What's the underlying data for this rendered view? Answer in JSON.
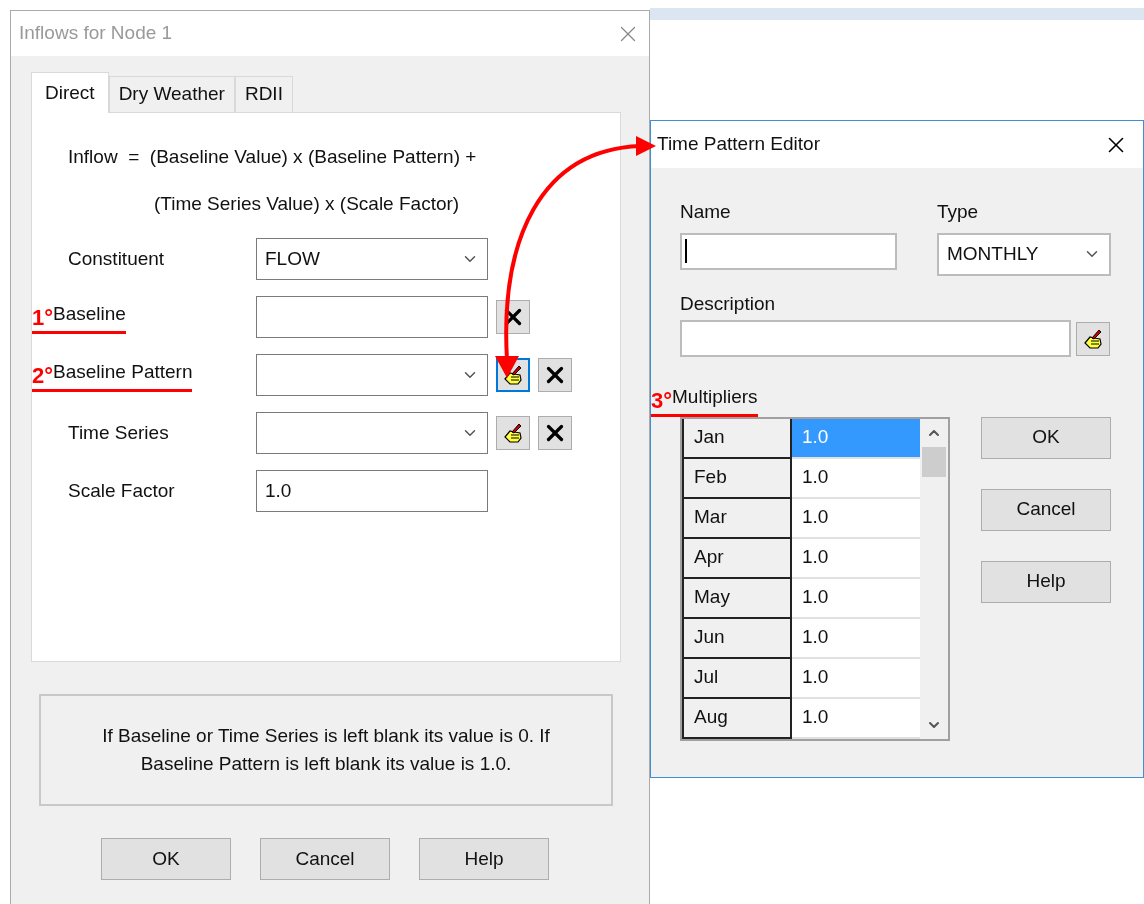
{
  "inflows_dialog": {
    "title": "Inflows for Node 1",
    "tabs": [
      {
        "label": "Direct",
        "selected": true
      },
      {
        "label": "Dry Weather",
        "selected": false
      },
      {
        "label": "RDII",
        "selected": false
      }
    ],
    "formula": [
      "Inflow  =  (Baseline Value) x (Baseline Pattern) +",
      "(Time Series Value) x (Scale Factor)"
    ],
    "fields": [
      {
        "label": "Constituent",
        "kind": "dropdown",
        "value": "FLOW"
      },
      {
        "label": "Baseline",
        "kind": "text",
        "annotation": "1°",
        "buttons": [
          {
            "kind": "clear",
            "focused": false
          }
        ]
      },
      {
        "label": "Baseline Pattern",
        "kind": "dropdown",
        "annotation": "2°",
        "buttons": [
          {
            "kind": "edit",
            "focused": true
          },
          {
            "kind": "clear",
            "focused": false
          }
        ]
      },
      {
        "label": "Time Series",
        "kind": "dropdown",
        "buttons": [
          {
            "kind": "edit",
            "focused": false
          },
          {
            "kind": "clear",
            "focused": false
          }
        ]
      },
      {
        "label": "Scale Factor",
        "kind": "text",
        "value": "1.0"
      }
    ],
    "note": "If Baseline or Time Series is left blank its value is 0. If Baseline Pattern is left blank its value is 1.0.",
    "buttons": [
      "OK",
      "Cancel",
      "Help"
    ]
  },
  "pattern_editor": {
    "title": "Time Pattern Editor",
    "name": {
      "label": "Name",
      "focused": true
    },
    "type": {
      "label": "Type",
      "value": "MONTHLY"
    },
    "description": {
      "label": "Description"
    },
    "multipliers": {
      "label": "Multipliers",
      "annotation": "3°",
      "rows": [
        {
          "month": "Jan",
          "value": "1.0",
          "selected": true
        },
        {
          "month": "Feb",
          "value": "1.0",
          "selected": false
        },
        {
          "month": "Mar",
          "value": "1.0",
          "selected": false
        },
        {
          "month": "Apr",
          "value": "1.0",
          "selected": false
        },
        {
          "month": "May",
          "value": "1.0",
          "selected": false
        },
        {
          "month": "Jun",
          "value": "1.0",
          "selected": false
        },
        {
          "month": "Jul",
          "value": "1.0",
          "selected": false
        },
        {
          "month": "Aug",
          "value": "1.0",
          "selected": false
        }
      ]
    },
    "buttons": [
      "OK",
      "Cancel",
      "Help"
    ]
  }
}
